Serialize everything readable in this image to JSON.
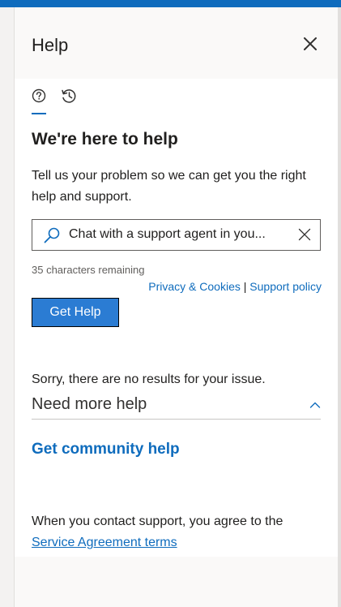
{
  "panel": {
    "title": "Help",
    "close_icon": "close-icon",
    "tabs": [
      {
        "icon": "help-circle-icon",
        "active": true
      },
      {
        "icon": "history-icon",
        "active": false
      }
    ]
  },
  "main": {
    "heading": "We're here to help",
    "description": "Tell us your problem so we can get you the right help and support.",
    "search": {
      "value": "Chat with a support agent in you...",
      "icon": "search-icon",
      "clear_icon": "clear-icon",
      "remaining": "35 characters remaining"
    },
    "links": {
      "privacy": "Privacy & Cookies",
      "separator": "|",
      "support_policy": "Support policy"
    },
    "get_help_label": "Get Help",
    "no_results": "Sorry, there are no results for your issue.",
    "need_more_help": "Need more help",
    "community_help": "Get community help",
    "agreement_text": "When you contact support, you agree to the",
    "agreement_link": "Service Agreement terms"
  },
  "colors": {
    "accent": "#0f6cbd",
    "button": "#2b7cd3",
    "panel_background": "#faf9f8",
    "content_background": "#ffffff"
  }
}
